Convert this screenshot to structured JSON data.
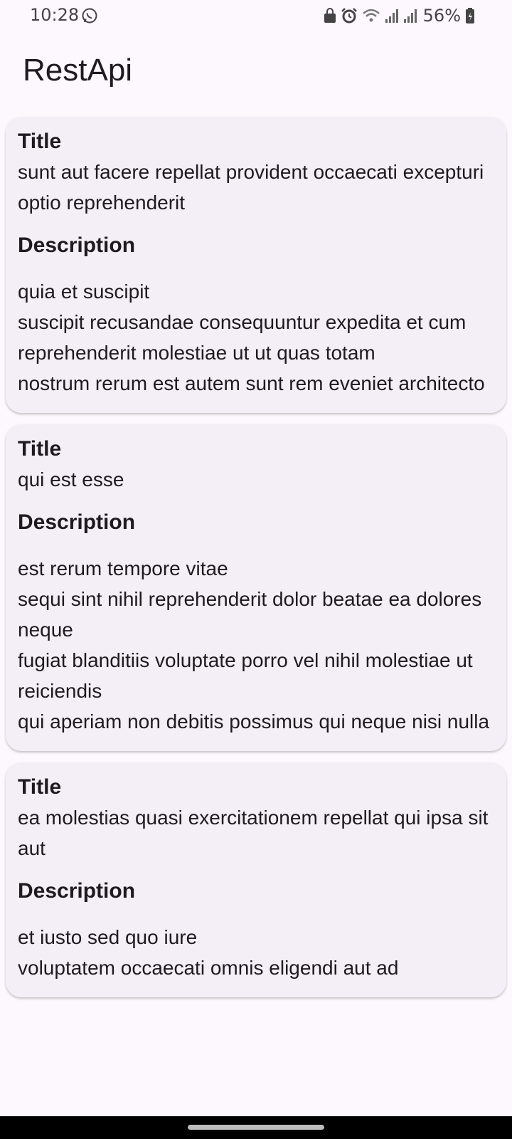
{
  "status_bar": {
    "time": "10:28",
    "battery_percent": "56%",
    "icons": [
      "whatsapp-icon",
      "lock-notification-icon",
      "alarm-icon",
      "wifi-icon",
      "signal-icon",
      "signal-icon",
      "battery-icon"
    ]
  },
  "app_bar": {
    "title": "RestApi"
  },
  "labels": {
    "title": "Title",
    "description": "Description"
  },
  "posts": [
    {
      "title": "sunt aut facere repellat provident occaecati excepturi optio reprehenderit",
      "body": "quia et suscipit\nsuscipit recusandae consequuntur expedita et cum\nreprehenderit molestiae ut ut quas totam\nnostrum rerum est autem sunt rem eveniet architecto"
    },
    {
      "title": "qui est esse",
      "body": "est rerum tempore vitae\nsequi sint nihil reprehenderit dolor beatae ea dolores neque\nfugiat blanditiis voluptate porro vel nihil molestiae ut reiciendis\nqui aperiam non debitis possimus qui neque nisi nulla"
    },
    {
      "title": "ea molestias quasi exercitationem repellat qui ipsa sit aut",
      "body": "et iusto sed quo iure\nvoluptatem occaecati omnis eligendi aut ad"
    }
  ],
  "colors": {
    "background": "#fdf7fe",
    "card": "#f4eff6",
    "text": "#1d1b20"
  }
}
